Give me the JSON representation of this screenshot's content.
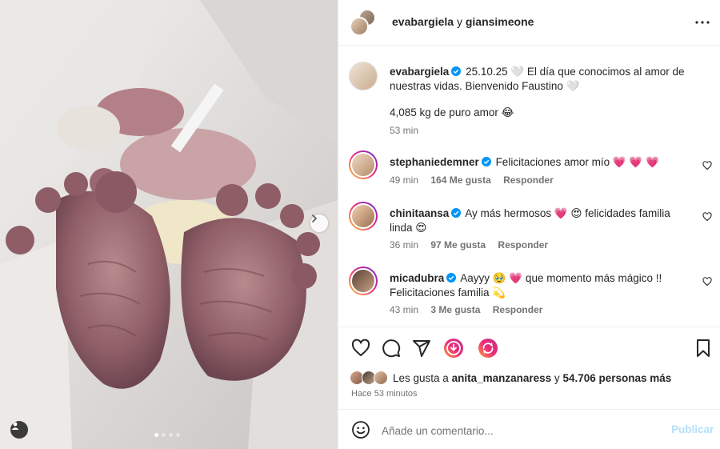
{
  "header": {
    "user1": "evabargiela",
    "connector": " y ",
    "user2": "giansimeone",
    "more_icon": "more-horizontal-icon"
  },
  "caption": {
    "username": "evabargiela",
    "text": "25.10.25 🤍  El día que conocimos al amor de nuestras vidas. Bienvenido Faustino 🤍",
    "text2": "4,085 kg de puro amor 😂",
    "time": "53 min"
  },
  "comments": [
    {
      "username": "stephaniedemner",
      "text": "Felicitaciones amor mío 💗 💗 💗",
      "time": "49 min",
      "likes": "164 Me gusta",
      "reply": "Responder"
    },
    {
      "username": "chinitaansa",
      "text": "Ay más hermosos 💗 😍 felicidades familia linda 😍",
      "time": "36 min",
      "likes": "97 Me gusta",
      "reply": "Responder"
    },
    {
      "username": "micadubra",
      "text": "Aayyy 🥹 💗  que momento más mágico !! Felicitaciones familia 💫",
      "time": "43 min",
      "likes": "3 Me gusta",
      "reply": "Responder"
    }
  ],
  "likes": {
    "prefix": "Les gusta a ",
    "user": "anita_manzanaress",
    "middle": " y ",
    "count": "54.706 personas más"
  },
  "time_ago": "Hace 53 minutos",
  "add_comment": {
    "placeholder": "Añade un comentario...",
    "post_label": "Publicar"
  },
  "carousel": {
    "current": 1,
    "total": 4
  },
  "colors": {
    "verified": "#0095f6",
    "post_disabled": "#b2dffc",
    "muted": "#737373",
    "story_ring_start": "#f9ce34",
    "story_ring_end": "#6228d7"
  },
  "icons": [
    "heart-icon",
    "comment-icon",
    "share-icon",
    "sticker-icon",
    "remix-icon",
    "bookmark-icon",
    "emoji-icon",
    "user-tag-icon",
    "chevron-right-icon",
    "verified-icon"
  ]
}
